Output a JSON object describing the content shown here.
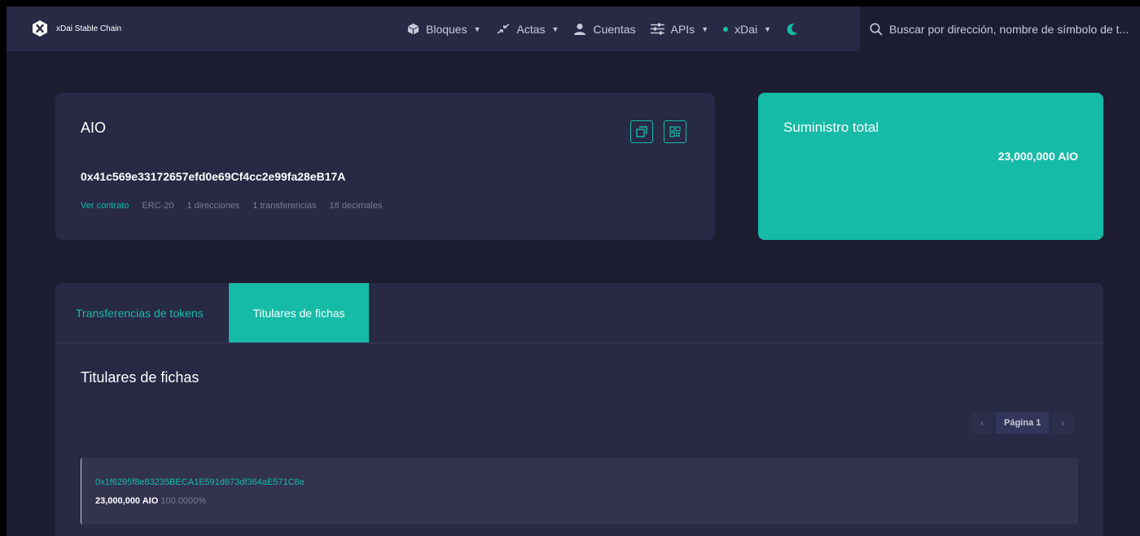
{
  "brand": {
    "name": "xDai Stable Chain"
  },
  "nav": {
    "blocks": "Bloques",
    "transactions": "Actas",
    "accounts": "Cuentas",
    "apis": "APIs",
    "network": "xDai"
  },
  "search": {
    "placeholder": "Buscar por dirección, nombre de símbolo de t..."
  },
  "token": {
    "name": "AIO",
    "address": "0x41c569e33172657efd0e69Cf4cc2e99fa28eB17A",
    "view_contract": "Ver contrato",
    "standard": "ERC-20",
    "addresses": "1 direcciones",
    "transfers": "1 transferencias",
    "decimals": "18 decimales"
  },
  "supply": {
    "title": "Suministro total",
    "value": "23,000,000 AIO"
  },
  "tabs": {
    "transfers": "Transferencias de tokens",
    "holders": "Titulares de fichas"
  },
  "holders": {
    "title": "Titulares de fichas",
    "page_label": "Página 1",
    "rows": [
      {
        "address": "0x1f6295f8e83235BECA1E591d673df364aE571C8e",
        "balance": "23,000,000 AIO",
        "percent": "100.0000%"
      }
    ]
  },
  "colors": {
    "accent": "#15bba6",
    "card": "#282945",
    "background": "#1c1d31"
  },
  "icons": [
    "xdai-logo-icon",
    "cube-icon",
    "transactions-icon",
    "user-icon",
    "sliders-icon",
    "caret-down-icon",
    "network-dot-icon",
    "moon-icon",
    "search-icon",
    "copy-icon",
    "qr-code-icon",
    "chevron-left-icon",
    "chevron-right-icon"
  ]
}
